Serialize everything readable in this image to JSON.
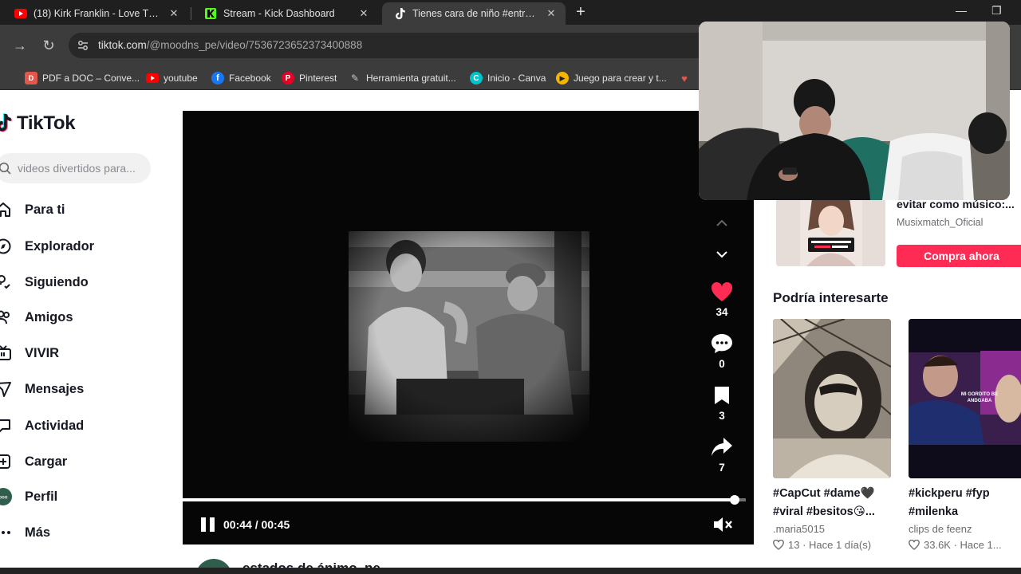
{
  "browser": {
    "tabs": [
      {
        "label": "(18) Kirk Franklin - Love Theory",
        "icon": "youtube-icon",
        "active": false
      },
      {
        "label": "Stream - Kick Dashboard",
        "icon": "kick-icon",
        "active": false
      },
      {
        "label": "Tienes cara de niño #entretenimiento",
        "icon": "tiktok-icon",
        "active": true
      }
    ],
    "url_domain": "tiktok.com",
    "url_path": "/@moodns_pe/video/7536723652373400888",
    "bookmarks": [
      {
        "label": "PDF a DOC – Conve...",
        "icon": "pdf-doc-icon",
        "color": "#e2574c"
      },
      {
        "label": "youtube",
        "icon": "youtube-icon",
        "color": "#ff0000"
      },
      {
        "label": "Facebook",
        "icon": "facebook-icon",
        "color": "#1877f2"
      },
      {
        "label": "Pinterest",
        "icon": "pinterest-icon",
        "color": "#e60023"
      },
      {
        "label": "Herramienta gratuit...",
        "icon": "tool-icon",
        "color": "#555555"
      },
      {
        "label": "Inicio - Canva",
        "icon": "canva-icon",
        "color": "#00c4cc"
      },
      {
        "label": "Juego para crear y t...",
        "icon": "game-icon",
        "color": "#f4b400"
      }
    ]
  },
  "tiktok": {
    "brand": "TikTok",
    "search_placeholder": "videos divertidos para...",
    "nav": [
      {
        "label": "Para ti",
        "icon": "home-icon"
      },
      {
        "label": "Explorador",
        "icon": "compass-icon"
      },
      {
        "label": "Siguiendo",
        "icon": "following-icon"
      },
      {
        "label": "Amigos",
        "icon": "friends-icon"
      },
      {
        "label": "VIVIR",
        "icon": "live-icon"
      },
      {
        "label": "Mensajes",
        "icon": "messages-icon"
      },
      {
        "label": "Actividad",
        "icon": "activity-icon"
      },
      {
        "label": "Cargar",
        "icon": "upload-icon"
      },
      {
        "label": "Perfil",
        "icon": "profile-avatar-icon"
      },
      {
        "label": "Más",
        "icon": "more-icon"
      }
    ],
    "player": {
      "time_display": "00:44 / 00:45",
      "progress_fraction": 0.98,
      "likes": "34",
      "comments": "0",
      "saves": "3",
      "shares": "7"
    },
    "author_name": "estados de ánimo_pe",
    "ad": {
      "title": "evitar como músico:...",
      "brand": "Musixmatch_Oficial",
      "cta": "Compra ahora"
    },
    "recommend_title": "Podría interesarte",
    "recommendations": [
      {
        "caption": "#CapCut #dame🖤 #viral #besitos😘...",
        "author": ".maria5015",
        "likes": "13",
        "time": "Hace 1 día(s)"
      },
      {
        "caption": "#kickperu #fyp #milenka",
        "author": "clips de feenz",
        "likes": "33.6K",
        "time": "Hace 1..."
      }
    ],
    "overlay_text": "MI GORDITO BE ANDGABA"
  },
  "colors": {
    "accent": "#fe2c55",
    "chrome_dark": "#1f1f1f",
    "chrome_mid": "#3c3c3c"
  }
}
